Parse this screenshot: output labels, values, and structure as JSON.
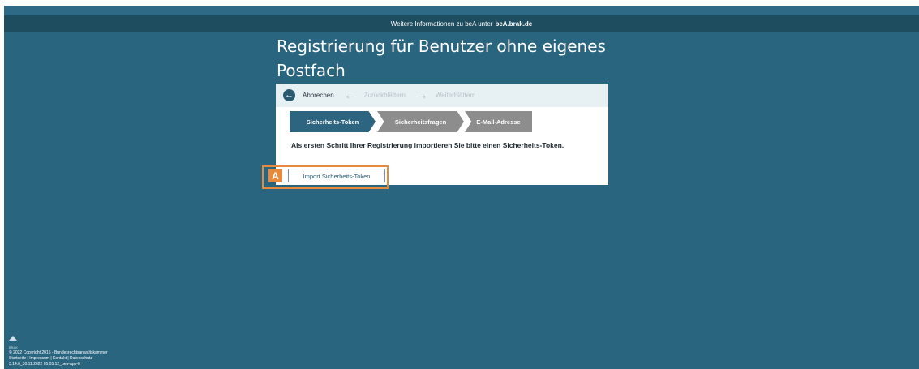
{
  "infobar": {
    "text": "Weitere Informationen zu beA unter",
    "link": "beA.brak.de"
  },
  "page_title": "Registrierung für Benutzer ohne eigenes Postfach",
  "toolbar": {
    "cancel_label": "Abbrechen",
    "back_label": "Zurückblättern",
    "forward_label": "Weiterblättern"
  },
  "steps": [
    {
      "label": "Sicherheits-Token",
      "active": true
    },
    {
      "label": "Sicherheitsfragen",
      "active": false
    },
    {
      "label": "E-Mail-Adresse",
      "active": false
    }
  ],
  "instruction": "Als ersten Schritt Ihrer Registrierung importieren Sie bitte einen Sicherheits-Token.",
  "import_button": "Import Sicherheits-Token",
  "annotation_badge": "A",
  "footer": {
    "logo_text": "BRAK",
    "copyright": "© 2022 Copyright 2015 - Bundesrechtsanwaltskammer",
    "links": "Startseite | Impressum | Kontakt | Datenschutz",
    "version": "3.14.0_30.11.2022 05:05:12_bea-app-0"
  },
  "colors": {
    "background": "#2a6580",
    "infobar": "#1f4d60",
    "active_step": "#2d6480",
    "inactive_step": "#8d8d8d",
    "highlight": "#e98a3a"
  }
}
